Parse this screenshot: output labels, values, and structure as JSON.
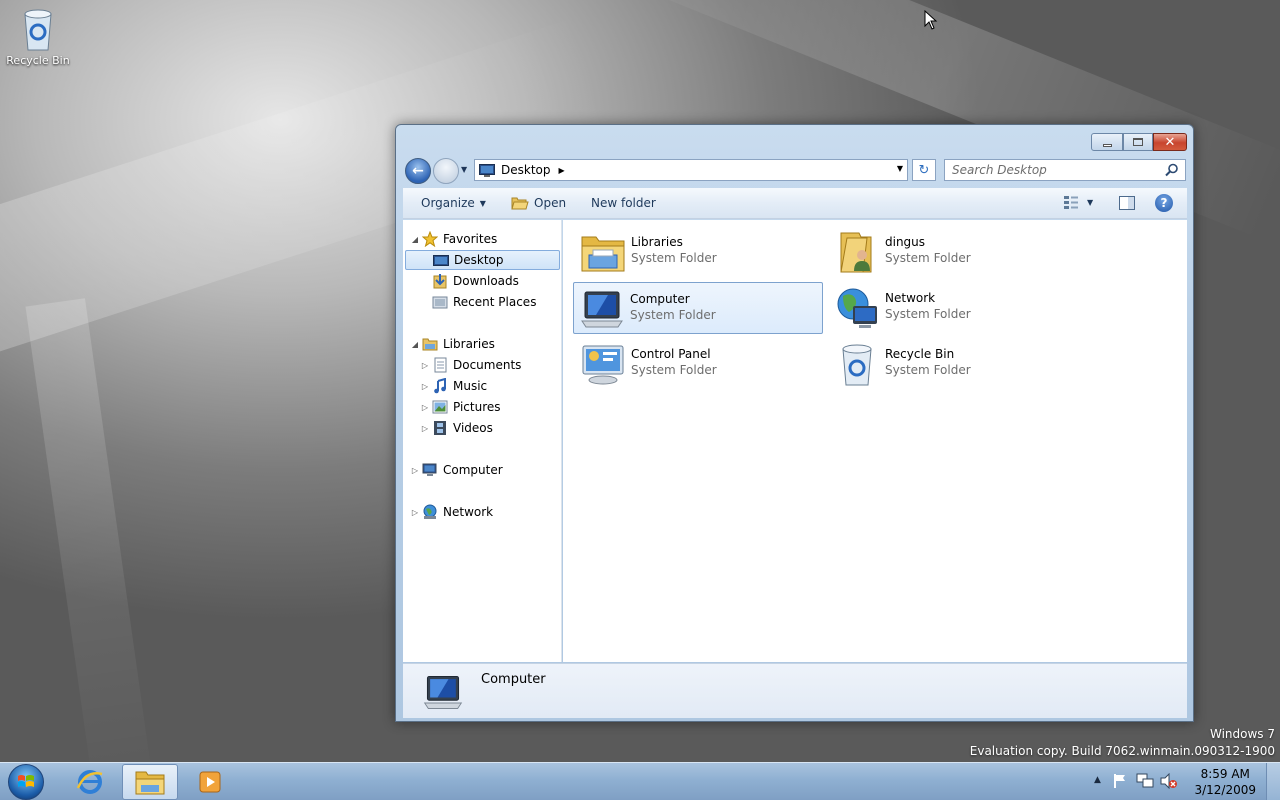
{
  "desktop": {
    "icons": [
      {
        "label": "Recycle Bin",
        "icon": "recycle-bin-icon"
      }
    ]
  },
  "explorer": {
    "address": {
      "location": "Desktop"
    },
    "search": {
      "placeholder": "Search Desktop"
    },
    "toolbar": {
      "organize_label": "Organize",
      "open_label": "Open",
      "new_folder_label": "New folder"
    },
    "nav": {
      "favorites": {
        "label": "Favorites",
        "items": [
          "Desktop",
          "Downloads",
          "Recent Places"
        ]
      },
      "libraries": {
        "label": "Libraries",
        "items": [
          "Documents",
          "Music",
          "Pictures",
          "Videos"
        ]
      },
      "computer": {
        "label": "Computer"
      },
      "network": {
        "label": "Network"
      },
      "selected": "Desktop"
    },
    "items": [
      {
        "name": "Libraries",
        "type": "System Folder",
        "icon": "libraries-folder-icon"
      },
      {
        "name": "dingus",
        "type": "System Folder",
        "icon": "user-folder-icon"
      },
      {
        "name": "Computer",
        "type": "System Folder",
        "icon": "computer-icon"
      },
      {
        "name": "Network",
        "type": "System Folder",
        "icon": "network-globe-icon"
      },
      {
        "name": "Control Panel",
        "type": "System Folder",
        "icon": "control-panel-icon"
      },
      {
        "name": "Recycle Bin",
        "type": "System Folder",
        "icon": "recycle-bin-icon"
      }
    ],
    "selected_item": "Computer",
    "details": {
      "name": "Computer"
    }
  },
  "watermark": {
    "line1": "Windows 7",
    "line2": "Evaluation copy. Build 7062.winmain.090312-1900"
  },
  "taskbar": {
    "pinned": [
      {
        "name": "internet-explorer",
        "icon": "internet-explorer-icon"
      },
      {
        "name": "windows-explorer",
        "icon": "folder-libraries-icon",
        "active": true
      },
      {
        "name": "media-player",
        "icon": "media-player-icon"
      }
    ],
    "clock": {
      "time": "8:59 AM",
      "date": "3/12/2009"
    }
  },
  "colors": {
    "selection": "#cfe3f8",
    "accent": "#2d63b4",
    "taskbar": "#8fb0d2"
  }
}
